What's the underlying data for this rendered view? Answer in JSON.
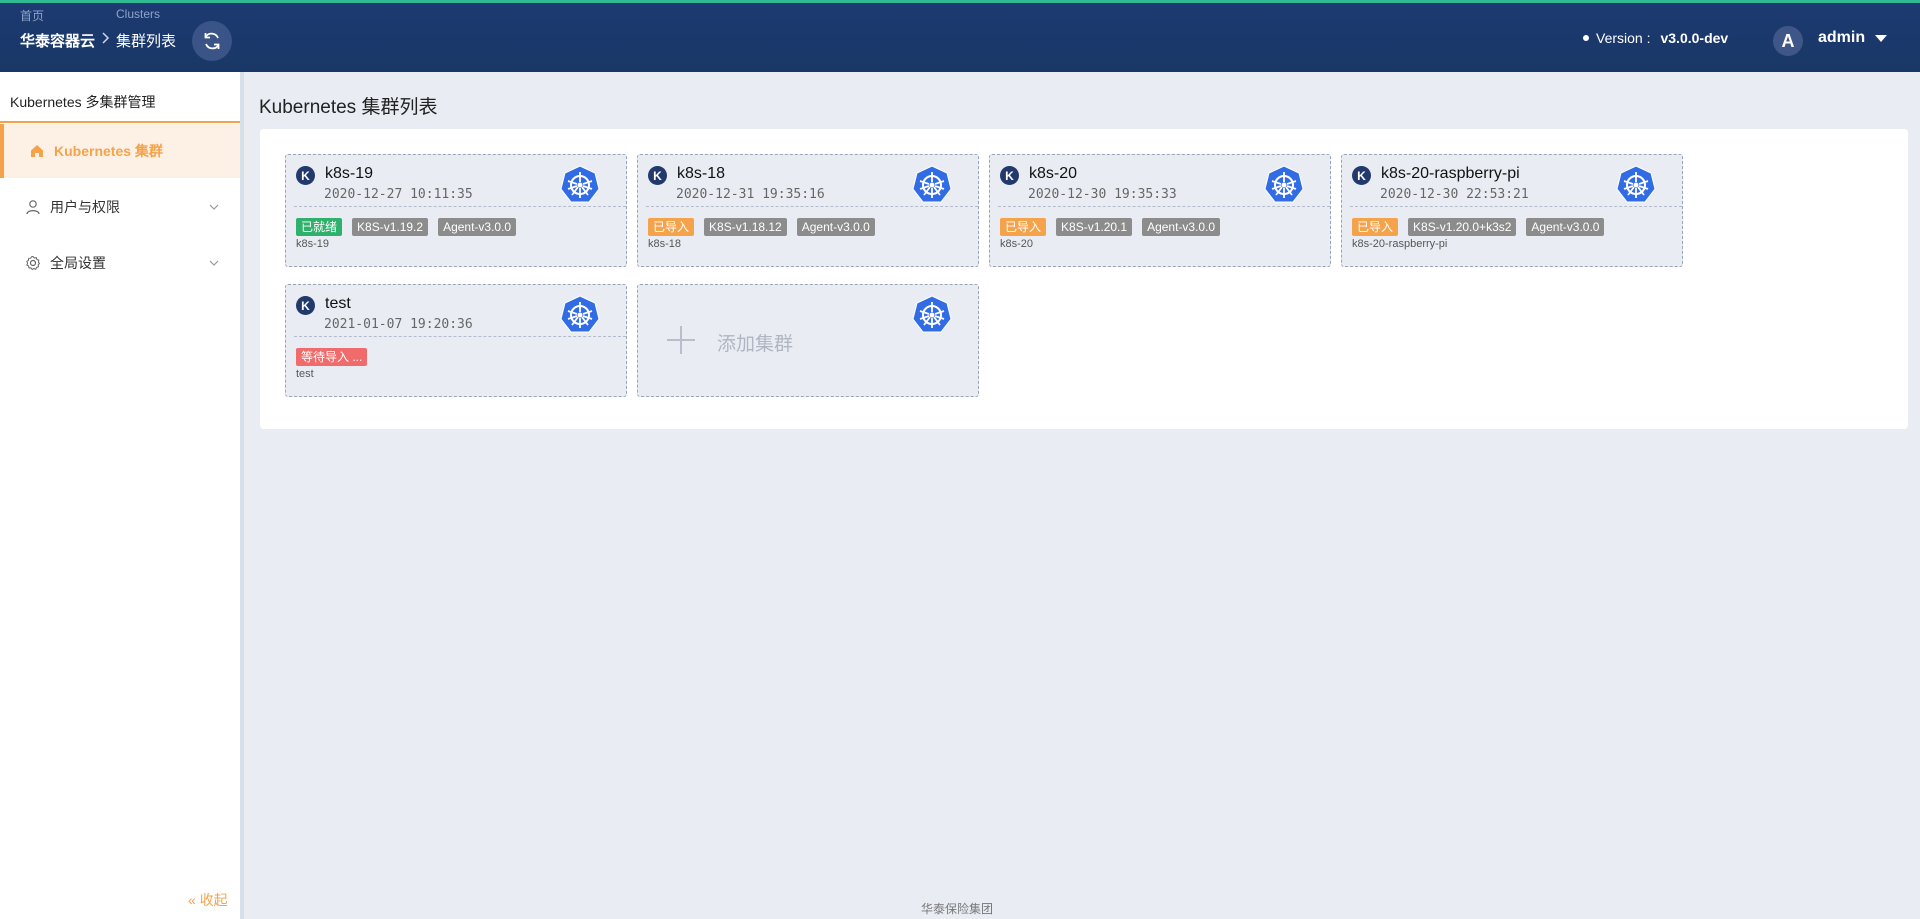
{
  "header": {
    "breadcrumb_small_1": "首页",
    "breadcrumb_small_2": "Clusters",
    "breadcrumb_main_1": "华泰容器云",
    "breadcrumb_main_2": "集群列表",
    "version_label": "Version :",
    "version_value": "v3.0.0-dev",
    "avatar_letter": "A",
    "username": "admin"
  },
  "sidebar": {
    "title": "Kubernetes 多集群管理",
    "items": [
      {
        "label": "Kubernetes 集群",
        "icon": "home-icon",
        "active": true
      },
      {
        "label": "用户与权限",
        "icon": "user-icon"
      },
      {
        "label": "全局设置",
        "icon": "gear-icon"
      }
    ],
    "collapse_label": "收起"
  },
  "main": {
    "page_title": "Kubernetes 集群列表",
    "clusters": [
      {
        "badge": "K",
        "name": "k8s-19",
        "time": "2020-12-27 10:11:35",
        "tags": [
          {
            "text": "已就绪",
            "color": "#2fb16b"
          },
          {
            "text": "K8S-v1.19.2",
            "color": "#8c8c8c"
          },
          {
            "text": "Agent-v3.0.0",
            "color": "#8c8c8c"
          }
        ],
        "desc": "k8s-19"
      },
      {
        "badge": "K",
        "name": "k8s-18",
        "time": "2020-12-31 19:35:16",
        "tags": [
          {
            "text": "已导入",
            "color": "#f5a34b"
          },
          {
            "text": "K8S-v1.18.12",
            "color": "#8c8c8c"
          },
          {
            "text": "Agent-v3.0.0",
            "color": "#8c8c8c"
          }
        ],
        "desc": "k8s-18"
      },
      {
        "badge": "K",
        "name": "k8s-20",
        "time": "2020-12-30 19:35:33",
        "tags": [
          {
            "text": "已导入",
            "color": "#f5a34b"
          },
          {
            "text": "K8S-v1.20.1",
            "color": "#8c8c8c"
          },
          {
            "text": "Agent-v3.0.0",
            "color": "#8c8c8c"
          }
        ],
        "desc": "k8s-20"
      },
      {
        "badge": "K",
        "name": "k8s-20-raspberry-pi",
        "time": "2020-12-30 22:53:21",
        "tags": [
          {
            "text": "已导入",
            "color": "#f5a34b"
          },
          {
            "text": "K8S-v1.20.0+k3s2",
            "color": "#8c8c8c"
          },
          {
            "text": "Agent-v3.0.0",
            "color": "#8c8c8c"
          }
        ],
        "desc": "k8s-20-raspberry-pi"
      },
      {
        "badge": "K",
        "name": "test",
        "time": "2021-01-07 19:20:36",
        "tags": [
          {
            "text": "等待导入 ...",
            "color": "#f06b6b"
          }
        ],
        "desc": "test"
      }
    ],
    "add_label": "添加集群"
  },
  "footer": {
    "text": "华泰保险集团"
  },
  "colors": {
    "header_bg": "#1d3a72",
    "accent": "#f5a34b",
    "k8s_blue": "#326ce5"
  }
}
